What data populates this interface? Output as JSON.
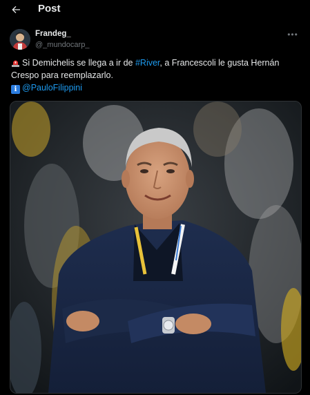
{
  "header": {
    "title": "Post",
    "back_icon": "arrow-left-icon"
  },
  "author": {
    "display_name": "Frandeg_",
    "handle": "@_mundocarp_",
    "more_icon": "more-horizontal-icon"
  },
  "tweet": {
    "line1_a": "Si Demichelis se llega a ir de ",
    "line1_link": "#River",
    "line1_b": ", a Francescoli le gusta Hernán",
    "line2": "Crespo para reemplazarlo.",
    "line3_link": "@PauloFilippini",
    "siren_icon": "police-light-emoji",
    "info_icon": "information-emoji"
  },
  "media": {
    "kind": "photo",
    "subject": "smiling man with arms crossed in navy jacket"
  },
  "colors": {
    "background": "#000000",
    "text": "#e7e9ea",
    "muted": "#71767b",
    "link": "#1d9bf0"
  }
}
